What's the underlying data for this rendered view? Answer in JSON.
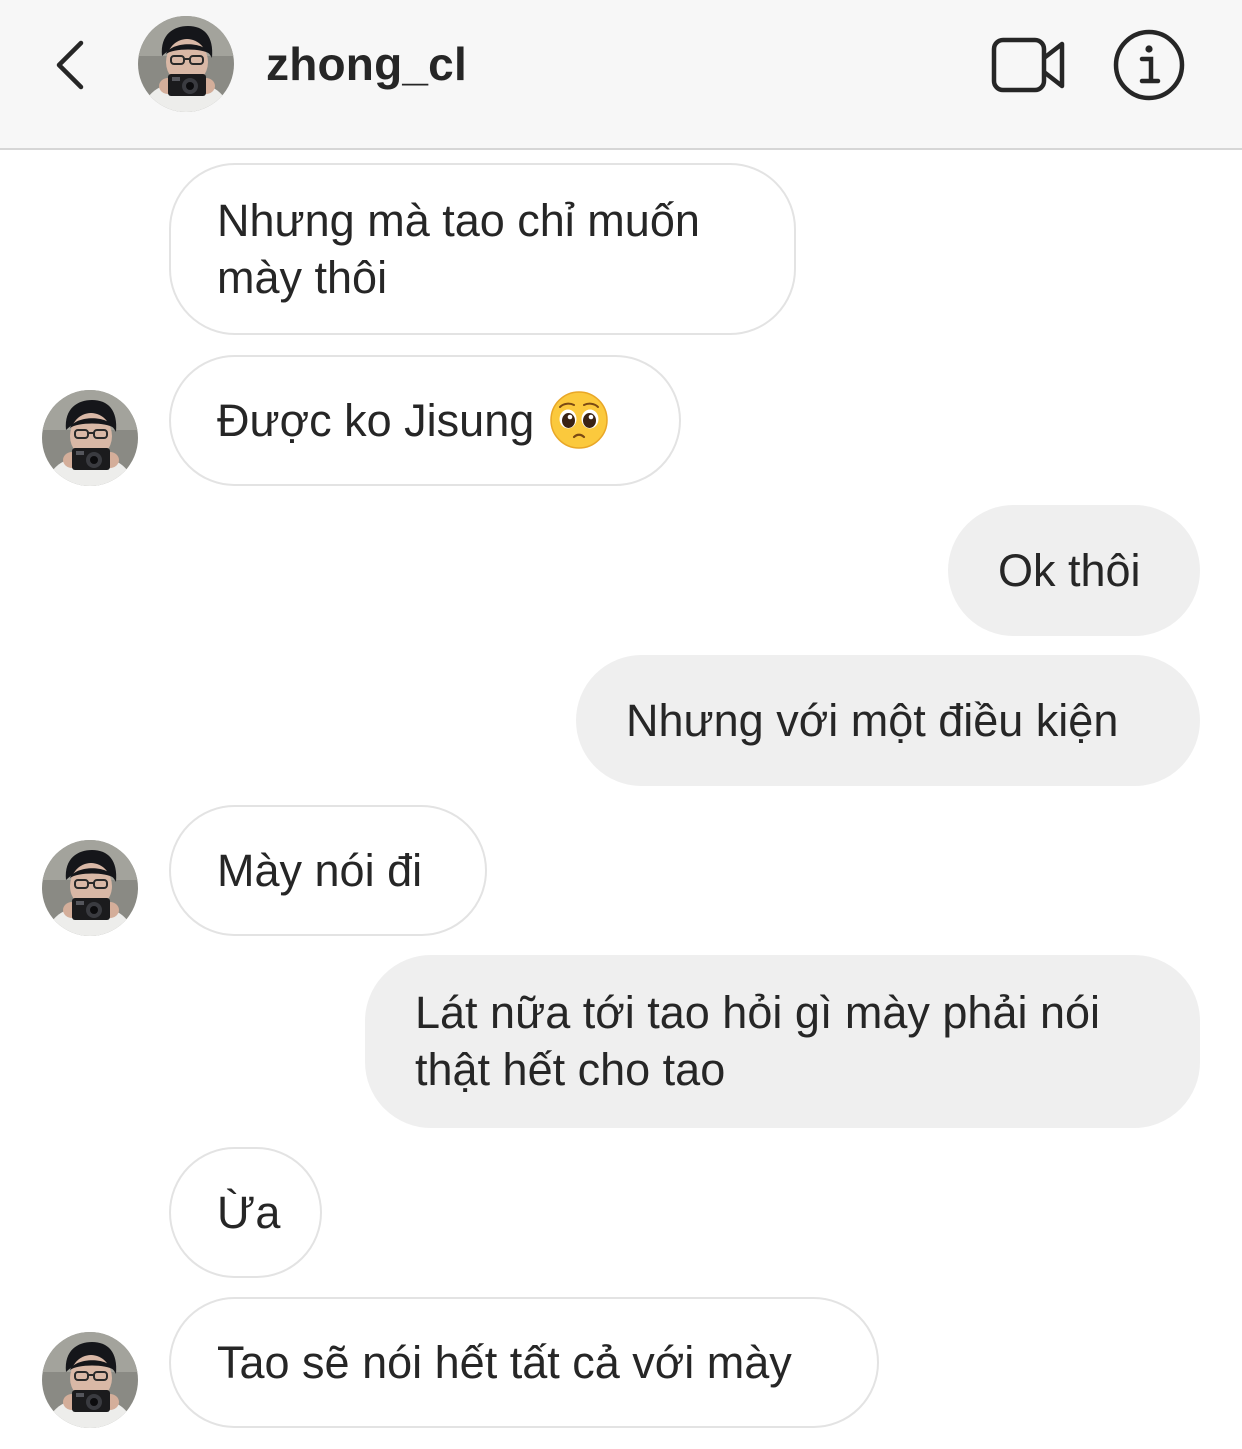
{
  "header": {
    "username": "zhong_cl",
    "back_icon": "chevron-left-icon",
    "video_icon": "video-camera-icon",
    "info_icon": "info-icon"
  },
  "colors": {
    "header_bg": "#f7f7f7",
    "incoming_border": "#e3e3e3",
    "outgoing_bg": "#efefef",
    "text": "#262626"
  },
  "messages": [
    {
      "direction": "incoming",
      "text": "Nhưng mà tao chỉ muốn\nmày thôi",
      "show_avatar": false
    },
    {
      "direction": "incoming",
      "text": "Được ko Jisung",
      "emoji": "pleading-face-emoji",
      "show_avatar": true
    },
    {
      "direction": "outgoing",
      "text": "Ok thôi"
    },
    {
      "direction": "outgoing",
      "text": "Nhưng với một điều kiện"
    },
    {
      "direction": "incoming",
      "text": "Mày nói đi",
      "show_avatar": true
    },
    {
      "direction": "outgoing",
      "text": "Lát nữa tới tao hỏi gì mày phải nói\nthật hết cho tao"
    },
    {
      "direction": "incoming",
      "text": "Ừa",
      "show_avatar": false
    },
    {
      "direction": "incoming",
      "text": "Tao sẽ nói hết tất cả với mày",
      "show_avatar": true
    }
  ]
}
